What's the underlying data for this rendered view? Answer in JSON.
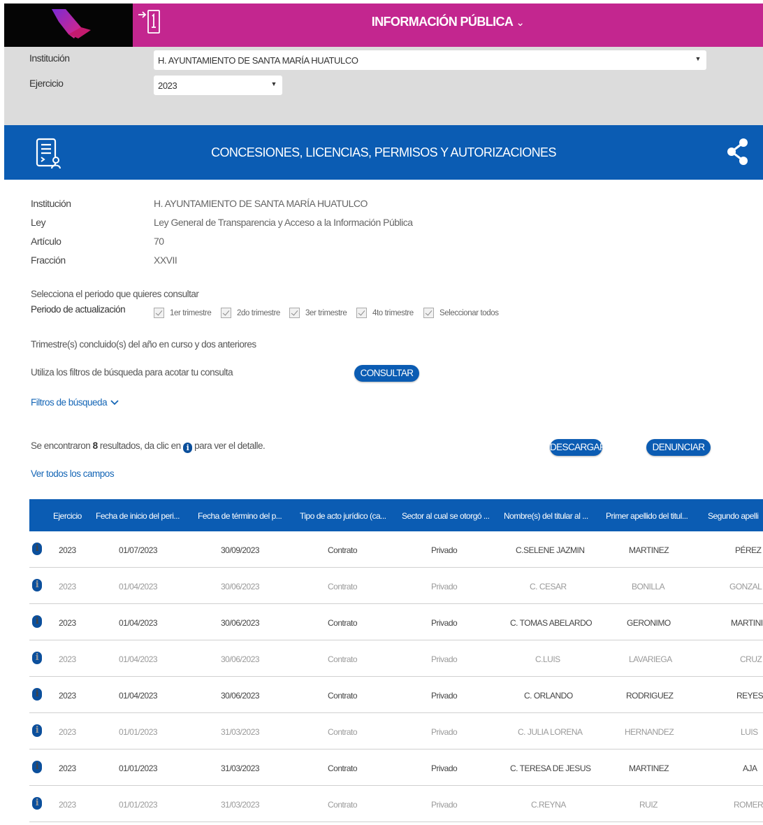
{
  "header": {
    "title": "INFORMACIÓN PÚBLICA",
    "chevron": "⌄",
    "accent_color": "#c3268f"
  },
  "filters": {
    "institucion_label": "Institución",
    "institucion_value": "H. AYUNTAMIENTO DE SANTA MARÍA HUATULCO",
    "ejercicio_label": "Ejercicio",
    "ejercicio_value": "2023"
  },
  "banner": {
    "title": "CONCESIONES, LICENCIAS, PERMISOS Y AUTORIZACIONES",
    "color": "#0b5cb3"
  },
  "info": [
    {
      "label": "Institución",
      "value": "H. AYUNTAMIENTO DE SANTA MARÍA HUATULCO"
    },
    {
      "label": "Ley",
      "value": "Ley General de Transparencia y Acceso a la Información Pública"
    },
    {
      "label": "Artículo",
      "value": "70"
    },
    {
      "label": "Fracción",
      "value": "XXVII"
    }
  ],
  "period": {
    "prompt": "Selecciona el periodo que quieres consultar",
    "label": "Periodo de actualización",
    "options": [
      "1er trimestre",
      "2do trimestre",
      "3er trimestre",
      "4to trimestre",
      "Seleccionar todos"
    ],
    "note": "Trimestre(s) concluido(s) del año en curso y dos anteriores"
  },
  "search": {
    "hint": "Utiliza los filtros de búsqueda para acotar tu consulta",
    "consultar_label": "CONSULTAR",
    "filters_link": "Filtros de búsqueda"
  },
  "results": {
    "prefix": "Se encontraron ",
    "count": "8",
    "middle": " resultados, da clic en ",
    "suffix": " para ver el detalle.",
    "info_glyph": "i",
    "descargar_label": "DESCARGAR",
    "denunciar_label": "DENUNCIAR",
    "ver_todos": "Ver todos los campos"
  },
  "table": {
    "columns": [
      "Ejercicio",
      "Fecha de inicio del peri...",
      "Fecha de término del p...",
      "Tipo de acto jurídico (ca...",
      "Sector al cual se otorgó ...",
      "Nombre(s) del titular al ...",
      "Primer apellido del titul...",
      "Segundo apelli"
    ],
    "rows": [
      [
        "2023",
        "01/07/2023",
        "30/09/2023",
        "Contrato",
        "Privado",
        "C.SELENE JAZMIN",
        "MARTINEZ",
        "PÉREZ"
      ],
      [
        "2023",
        "01/04/2023",
        "30/06/2023",
        "Contrato",
        "Privado",
        "C. CESAR",
        "BONILLA",
        "GONZAL"
      ],
      [
        "2023",
        "01/04/2023",
        "30/06/2023",
        "Contrato",
        "Privado",
        "C. TOMAS ABELARDO",
        "GERONIMO",
        "MARTINI"
      ],
      [
        "2023",
        "01/04/2023",
        "30/06/2023",
        "Contrato",
        "Privado",
        "C.LUIS",
        "LAVARIEGA",
        "CRUZ"
      ],
      [
        "2023",
        "01/04/2023",
        "30/06/2023",
        "Contrato",
        "Privado",
        "C. ORLANDO",
        "RODRIGUEZ",
        "REYES"
      ],
      [
        "2023",
        "01/01/2023",
        "31/03/2023",
        "Contrato",
        "Privado",
        "C. JULIA LORENA",
        "HERNANDEZ",
        "LUIS"
      ],
      [
        "2023",
        "01/01/2023",
        "31/03/2023",
        "Contrato",
        "Privado",
        "C. TERESA DE JESUS",
        "MARTINEZ",
        "AJA"
      ],
      [
        "2023",
        "01/01/2023",
        "31/03/2023",
        "Contrato",
        "Privado",
        "C.REYNA",
        "RUIZ",
        "ROMER"
      ]
    ]
  }
}
